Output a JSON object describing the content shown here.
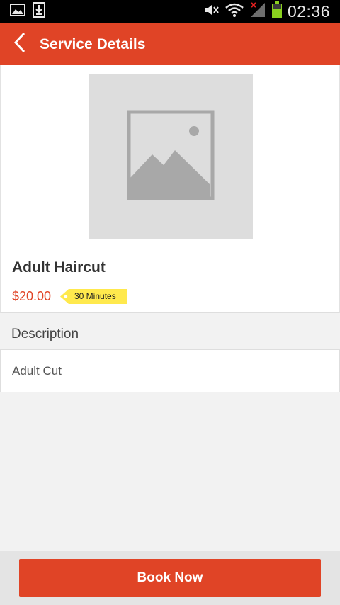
{
  "status_bar": {
    "time": "02:36",
    "icons": [
      "gallery-notification-icon",
      "download-notification-icon",
      "mute-icon",
      "wifi-icon",
      "signal-icon",
      "battery-icon"
    ]
  },
  "app_bar": {
    "title": "Service Details",
    "back_icon": "chevron-left-icon",
    "background": "#e04426"
  },
  "service": {
    "image_placeholder_icon": "image-placeholder-icon",
    "name": "Adult Haircut",
    "price": "$20.00",
    "duration": "30 Minutes"
  },
  "description": {
    "label": "Description",
    "text": "Adult Cut"
  },
  "footer": {
    "book_label": "Book Now"
  },
  "colors": {
    "accent": "#e04426",
    "tag": "#ffe94d"
  }
}
